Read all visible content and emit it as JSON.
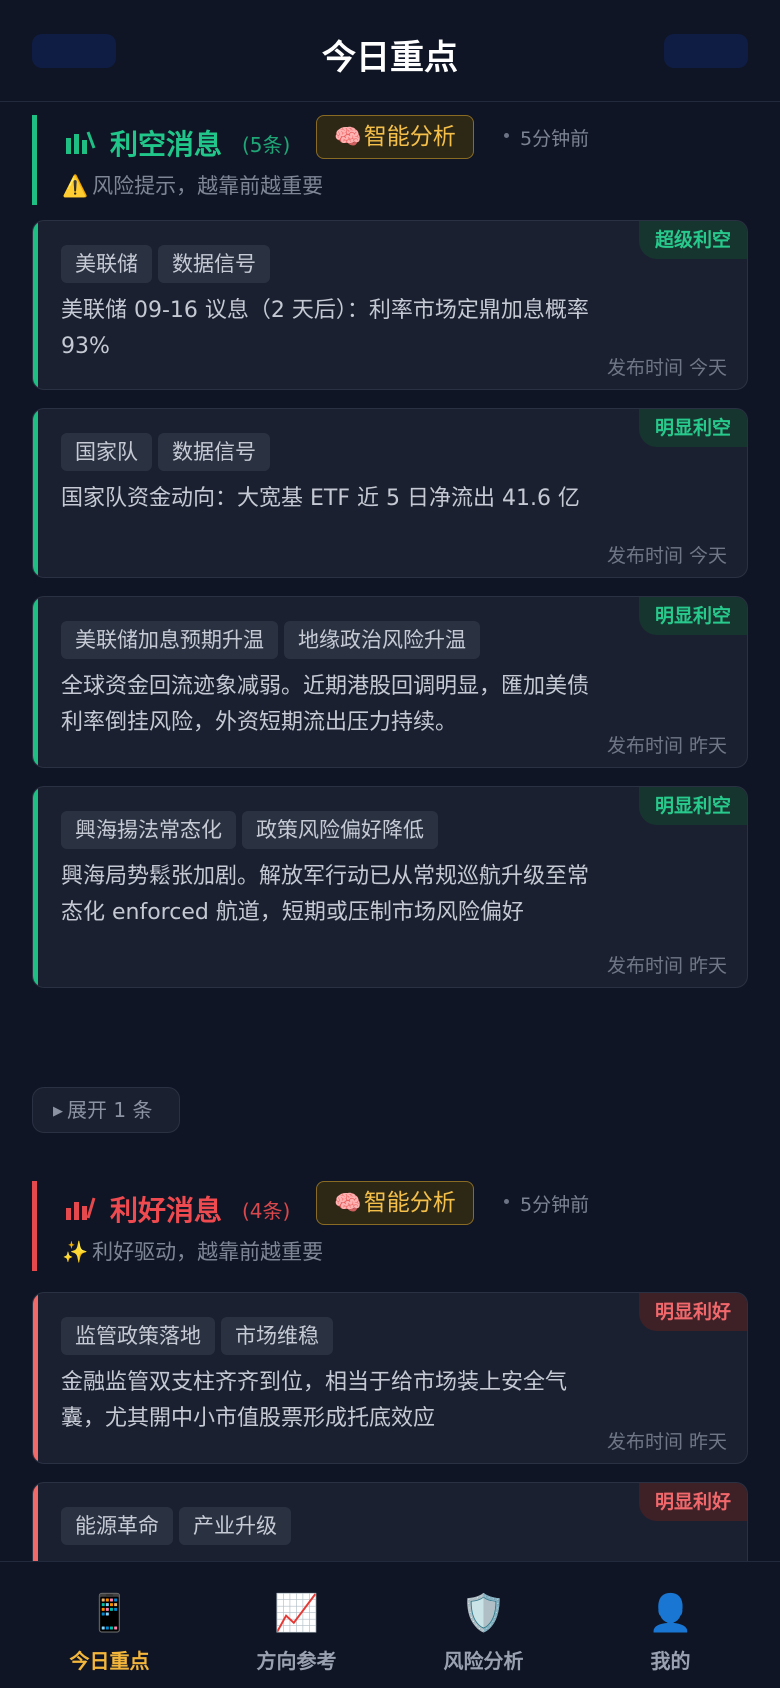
{
  "header": {
    "title": "今日重点"
  },
  "sections": [
    {
      "title": "利空消息",
      "count": "(5条)",
      "ai_label": "智能分析",
      "time": "5分钟前",
      "hint_icon": "⚠️",
      "hint": "风险提示，越靠前越重要",
      "cards": [
        {
          "badge": "超级利空",
          "tags": [
            "美联储",
            "数据信号"
          ],
          "body": "美联储 09-16 议息（2 天后）：利率市场定鼎加息概率 93%",
          "published": "发布时间 今天"
        },
        {
          "badge": "明显利空",
          "tags": [
            "国家队",
            "数据信号"
          ],
          "body": "国家队资金动向：大宽基 ETF 近 5 日净流出 41.6 亿",
          "published": "发布时间 今天"
        },
        {
          "badge": "明显利空",
          "tags": [
            "美联储加息预期升温",
            "地缘政治风险升温"
          ],
          "body": "全球资金回流迹象减弱。近期港股回调明显，匯加美债利率倒挂风险，外资短期流出压力持续。",
          "published": "发布时间 昨天"
        },
        {
          "badge": "明显利空",
          "tags": [
            "興海揚法常态化",
            "政策风险偏好降低"
          ],
          "body": "興海局势鬆张加剧。解放军行动已从常规巡航升级至常态化 enforced 航道，短期或压制市场风险偏好",
          "published": "发布时间 昨天"
        }
      ],
      "expand_label": "展开 1 条"
    },
    {
      "title": "利好消息",
      "count": "(4条)",
      "ai_label": "智能分析",
      "time": "5分钟前",
      "hint_icon": "✨",
      "hint": "利好驱动，越靠前越重要",
      "cards": [
        {
          "badge": "明显利好",
          "tags": [
            "监管政策落地",
            "市场维稳"
          ],
          "body": "金融监管双支柱齐齐到位，相当于给市场装上安全气囊，尤其開中小市值股票形成托底效应",
          "published": "发布时间 昨天"
        },
        {
          "badge": "明显利好",
          "tags": [
            "能源革命",
            "产业升级"
          ]
        }
      ]
    }
  ],
  "tabbar": {
    "items": [
      {
        "label": "今日重点",
        "icon": "📱",
        "active": true
      },
      {
        "label": "方向参考",
        "icon": "📈"
      },
      {
        "label": "风险分析",
        "icon": "🛡️"
      },
      {
        "label": "我的",
        "icon": "👤"
      }
    ]
  },
  "colors": {
    "background": "#0f1524",
    "card": "#1b2030",
    "bear_green": "#1fbf84",
    "bull_red": "#e5484d",
    "ai_gold": "#f5c04a",
    "active_tab": "#f4b73c"
  },
  "icons": {
    "bear_section": "bar-chart-down-icon",
    "bull_section": "bar-chart-up-icon",
    "ai": "brain-icon"
  }
}
